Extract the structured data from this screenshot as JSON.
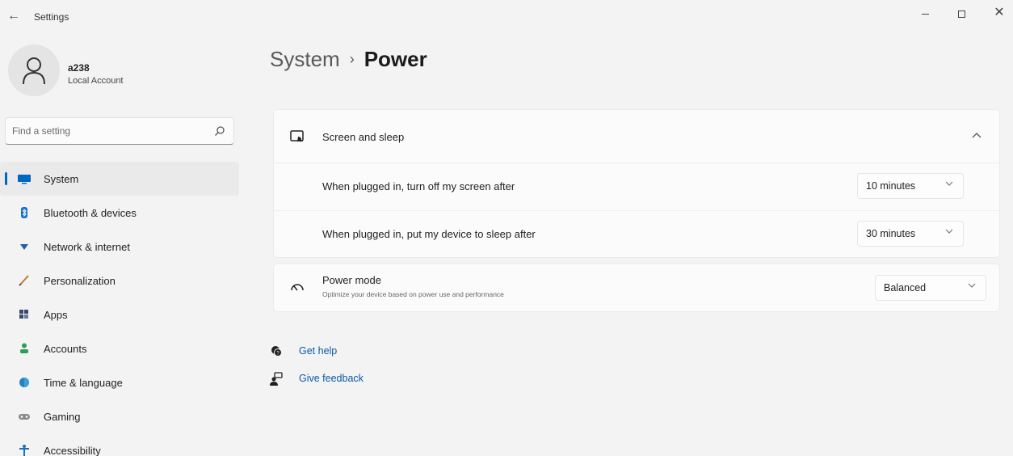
{
  "window": {
    "title": "Settings",
    "back_glyph": "←",
    "close_glyph": "✕"
  },
  "profile": {
    "name": "a238",
    "account_type": "Local Account"
  },
  "search": {
    "placeholder": "Find a setting",
    "value": ""
  },
  "sidebar": {
    "items": [
      {
        "label": "System",
        "icon": "system-display-icon",
        "active": true
      },
      {
        "label": "Bluetooth & devices",
        "icon": "bluetooth-icon"
      },
      {
        "label": "Network & internet",
        "icon": "network-wifi-icon"
      },
      {
        "label": "Personalization",
        "icon": "brush-icon"
      },
      {
        "label": "Apps",
        "icon": "apps-icon"
      },
      {
        "label": "Accounts",
        "icon": "accounts-icon"
      },
      {
        "label": "Time & language",
        "icon": "globe-clock-icon"
      },
      {
        "label": "Gaming",
        "icon": "gamepad-icon"
      },
      {
        "label": "Accessibility",
        "icon": "accessibility-icon"
      }
    ]
  },
  "breadcrumb": {
    "parent": "System",
    "separator": "›",
    "current": "Power"
  },
  "screen_sleep": {
    "title": "Screen and sleep",
    "expanded": true,
    "rows": [
      {
        "label": "When plugged in, turn off my screen after",
        "value": "10 minutes"
      },
      {
        "label": "When plugged in, put my device to sleep after",
        "value": "30 minutes"
      }
    ]
  },
  "power_mode": {
    "title": "Power mode",
    "description": "Optimize your device based on power use and performance",
    "value": "Balanced"
  },
  "links": {
    "help": "Get help",
    "feedback": "Give feedback"
  },
  "colors": {
    "accent": "#0067c0",
    "background": "#f3f3f3",
    "card": "#fbfbfb",
    "link": "#0a5aa8"
  }
}
